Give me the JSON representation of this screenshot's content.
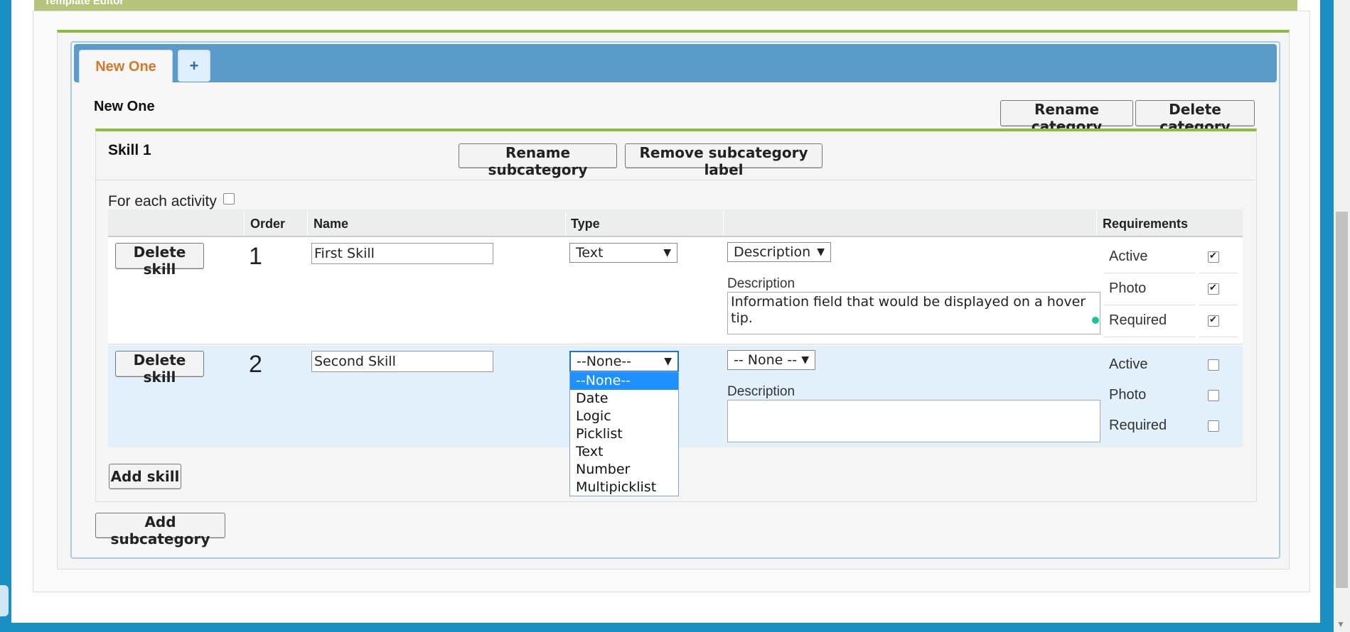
{
  "panel": {
    "title": "Template Editor"
  },
  "tabs": {
    "active_label": "New One",
    "add_label": "+"
  },
  "category": {
    "title": "New One",
    "rename_label": "Rename category",
    "delete_label": "Delete category"
  },
  "subcategory": {
    "title": "Skill 1",
    "rename_label": "Rename subcategory",
    "remove_label": "Remove subcategory label",
    "for_each_label": "For each activity",
    "for_each_checked": false
  },
  "table": {
    "headers": {
      "order": "Order",
      "name": "Name",
      "type": "Type",
      "extra": "",
      "requirements": "Requirements"
    },
    "rows": [
      {
        "delete_label": "Delete skill",
        "order": "1",
        "name": "First Skill",
        "type": "Text",
        "desc_mode": "Description",
        "desc_label": "Description",
        "description": "Information field that would be displayed on a hover tip.",
        "requirements": [
          {
            "label": "Active",
            "checked": true
          },
          {
            "label": "Photo",
            "checked": true
          },
          {
            "label": "Required",
            "checked": true
          }
        ]
      },
      {
        "delete_label": "Delete skill",
        "order": "2",
        "name": "Second Skill",
        "type": "--None--",
        "desc_mode": "-- None --",
        "desc_label": "Description",
        "description": "",
        "requirements": [
          {
            "label": "Active",
            "checked": false
          },
          {
            "label": "Photo",
            "checked": false
          },
          {
            "label": "Required",
            "checked": false
          }
        ]
      }
    ]
  },
  "type_dropdown": {
    "options": [
      "--None--",
      "Date",
      "Logic",
      "Picklist",
      "Text",
      "Number",
      "Multipicklist"
    ],
    "selected": "--None--"
  },
  "add_skill_label": "Add skill",
  "add_subcategory_label": "Add subcategory",
  "colors": {
    "accent_green": "#8dbb3c",
    "tab_header_blue": "#5b9bcc",
    "tab_text_orange": "#d6782b",
    "row_highlight": "#e2f0fb",
    "selected_option": "#1e90ff"
  }
}
